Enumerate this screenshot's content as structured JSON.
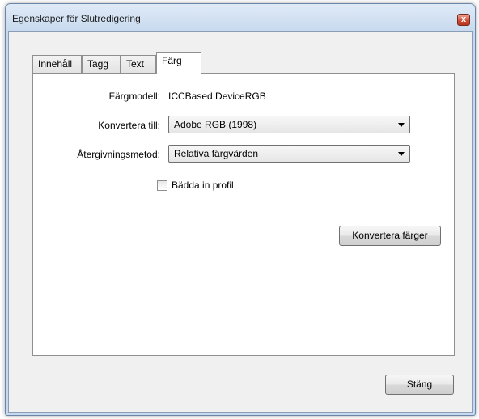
{
  "window": {
    "title": "Egenskaper för Slutredigering",
    "close_glyph": "x"
  },
  "tabs": [
    {
      "label": "Innehåll",
      "active": false
    },
    {
      "label": "Tagg",
      "active": false
    },
    {
      "label": "Text",
      "active": false
    },
    {
      "label": "Färg",
      "active": true
    }
  ],
  "color_panel": {
    "color_model_label": "Färgmodell:",
    "color_model_value": "ICCBased DeviceRGB",
    "convert_to_label": "Konvertera till:",
    "convert_to_value": "Adobe RGB (1998)",
    "rendering_intent_label": "Återgivningsmetod:",
    "rendering_intent_value": "Relativa färgvärden",
    "embed_profile_label": "Bädda in profil",
    "embed_profile_checked": false,
    "convert_button_label": "Konvertera färger"
  },
  "footer": {
    "close_button_label": "Stäng"
  }
}
